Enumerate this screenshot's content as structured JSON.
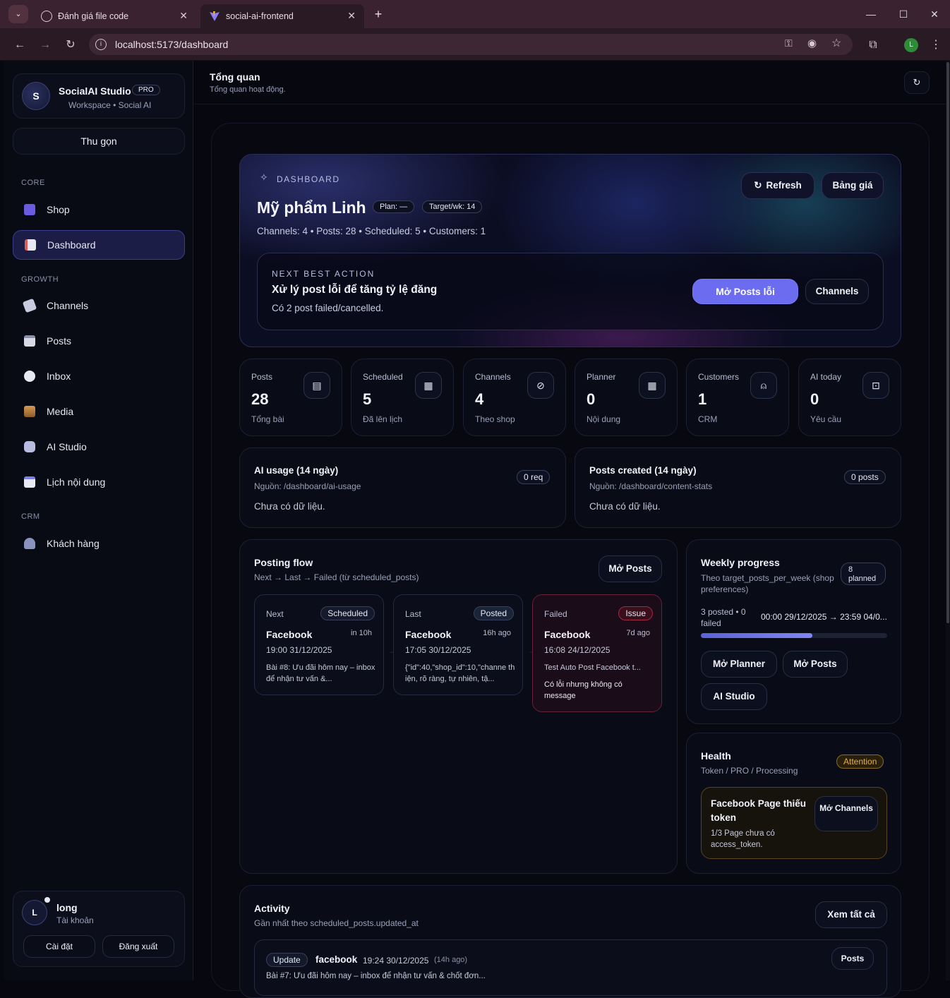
{
  "browser": {
    "tabs": [
      {
        "title": "Đánh giá file code"
      },
      {
        "title": "social-ai-frontend"
      }
    ],
    "url": "localhost:5173/dashboard",
    "profile_initial": "L"
  },
  "sidebar": {
    "brand": {
      "initial": "S",
      "name": "SocialAI Studio",
      "badge": "PRO",
      "sub": "Workspace • Social AI"
    },
    "collapse_label": "Thu gọn",
    "sections": {
      "core": "CORE",
      "growth": "GROWTH",
      "crm": "CRM"
    },
    "items": [
      {
        "label": "Shop",
        "icon": "shop-icon"
      },
      {
        "label": "Dashboard",
        "icon": "dashboard-icon"
      },
      {
        "label": "Channels",
        "icon": "channels-icon"
      },
      {
        "label": "Posts",
        "icon": "posts-icon"
      },
      {
        "label": "Inbox",
        "icon": "inbox-icon"
      },
      {
        "label": "Media",
        "icon": "media-icon"
      },
      {
        "label": "AI Studio",
        "icon": "ai-studio-icon"
      },
      {
        "label": "Lịch nội dung",
        "icon": "calendar-icon"
      },
      {
        "label": "Khách hàng",
        "icon": "customers-icon"
      }
    ],
    "user": {
      "initial": "L",
      "name": "long",
      "role": "Tài khoản",
      "settings": "Cài đặt",
      "logout": "Đăng xuất"
    }
  },
  "header": {
    "title": "Tổng quan",
    "subtitle": "Tổng quan hoạt động."
  },
  "hero": {
    "kicker": "DASHBOARD",
    "shop_name": "Mỹ phẩm Linh",
    "plan_pill": "Plan: —",
    "target_pill": "Target/wk: 14",
    "summary": "Channels: 4 • Posts: 28 • Scheduled: 5 • Customers: 1",
    "refresh": "Refresh",
    "pricing": "Bảng giá",
    "nba": {
      "kicker": "NEXT BEST ACTION",
      "title": "Xử lý post lỗi để tăng tỷ lệ đăng",
      "desc": "Có 2 post failed/cancelled.",
      "primary": "Mở Posts lỗi",
      "secondary": "Channels"
    }
  },
  "stats": [
    {
      "label": "Posts",
      "value": "28",
      "sub": "Tổng bài",
      "icon": "message-icon"
    },
    {
      "label": "Scheduled",
      "value": "5",
      "sub": "Đã lên lịch",
      "icon": "calendar-icon"
    },
    {
      "label": "Channels",
      "value": "4",
      "sub": "Theo shop",
      "icon": "link-icon"
    },
    {
      "label": "Planner",
      "value": "0",
      "sub": "Nội dung",
      "icon": "calendar-icon"
    },
    {
      "label": "Customers",
      "value": "1",
      "sub": "CRM",
      "icon": "user-icon"
    },
    {
      "label": "AI today",
      "value": "0",
      "sub": "Yêu cầu",
      "icon": "bot-icon"
    }
  ],
  "usage": {
    "ai": {
      "title": "AI usage (14 ngày)",
      "source": "Nguồn: /dashboard/ai-usage",
      "badge": "0 req",
      "empty": "Chưa có dữ liệu."
    },
    "posts": {
      "title": "Posts created (14 ngày)",
      "source": "Nguồn: /dashboard/content-stats",
      "badge": "0 posts",
      "empty": "Chưa có dữ liệu."
    }
  },
  "flow": {
    "title": "Posting flow",
    "subtitle": "Next → Last → Failed (từ scheduled_posts)",
    "open": "Mở Posts",
    "cards": [
      {
        "kind": "Next",
        "tag": "Scheduled",
        "channel": "Facebook",
        "ago": "in 10h",
        "datetime": "19:00 31/12/2025",
        "text": "Bài #8: Ưu đãi hôm nay – inbox để nhận tư vấn &..."
      },
      {
        "kind": "Last",
        "tag": "Posted",
        "channel": "Facebook",
        "ago": "16h ago",
        "datetime": "17:05 30/12/2025",
        "text": "{\"id\":40,\"shop_id\":10,\"channe thiện, rõ ràng, tự nhiên, tậ..."
      },
      {
        "kind": "Failed",
        "tag": "Issue",
        "channel": "Facebook",
        "ago": "7d ago",
        "datetime": "16:08 24/12/2025",
        "text": "Test Auto Post Facebook t...",
        "error": "Có lỗi nhưng không có message"
      }
    ]
  },
  "weekly": {
    "title": "Weekly progress",
    "subtitle": "Theo target_posts_per_week (shop preferences)",
    "badge_num": "8",
    "badge_text": "planned",
    "posted": "3 posted • 0 failed",
    "range": "00:00 29/12/2025 → 23:59 04/0...",
    "progress": 0.6,
    "buttons": [
      "Mở Planner",
      "Mở Posts",
      "AI Studio"
    ]
  },
  "health": {
    "title": "Health",
    "subtitle": "Token / PRO / Processing",
    "badge": "Attention",
    "issue_title": "Facebook Page thiếu token",
    "issue_desc": "1/3 Page chưa có access_token.",
    "issue_btn": "Mở Channels"
  },
  "activity": {
    "title": "Activity",
    "subtitle": "Gần nhất theo scheduled_posts.updated_at",
    "view_all": "Xem tất cả",
    "items": [
      {
        "tag": "Update",
        "channel": "facebook",
        "time": "19:24 30/12/2025",
        "ago": "(14h ago)",
        "text": "Bài #7: Ưu đãi hôm nay – inbox để nhận tư vấn & chốt đơn...",
        "btn": "Posts"
      }
    ]
  },
  "colors": {
    "accent": "#6b6cf0",
    "danger": "#c0304a",
    "warning": "#e3b04b"
  }
}
